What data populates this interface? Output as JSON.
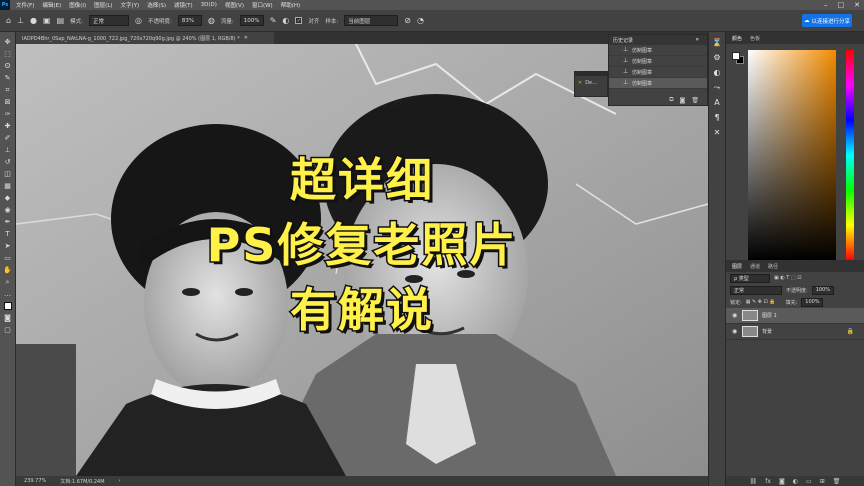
{
  "menu": {
    "app_icon": "Ps",
    "items": [
      "文件(F)",
      "编辑(E)",
      "图像(I)",
      "图层(L)",
      "文字(Y)",
      "选择(S)",
      "滤镜(T)",
      "3D(D)",
      "视图(V)",
      "窗口(W)",
      "帮助(H)"
    ],
    "window_controls": [
      "–",
      "□",
      "✕"
    ]
  },
  "options": {
    "mode_label": "模式:",
    "mode_value": "正常",
    "opacity_label": "不透明度:",
    "opacity_value": "83%",
    "flow_label": "流量:",
    "flow_value": "100%",
    "aligned_label": "对齐",
    "sample_label": "样本:",
    "sample_value": "当前图层",
    "share_label": "以连接进行分享"
  },
  "document": {
    "tab_title": "IADPD4Bhr_0Sap_NAtLNA-g_1000_722.jpg_720x720q90g.jpg @ 240% (图层 1, RGB/8) *",
    "tab_close": "✕"
  },
  "headline": {
    "line1": "超详细",
    "line2": "PS修复老照片",
    "line3": "有解说"
  },
  "status": {
    "zoom": "239.77%",
    "doc_size": "文档:1.67M/0.24M",
    "arrow": "›"
  },
  "mini_panel": {
    "label": "De..."
  },
  "history": {
    "title": "历史记录",
    "items": [
      "仿制图章",
      "仿制图章",
      "仿制图章",
      "仿制图章"
    ]
  },
  "color_panel": {
    "tabs": [
      "颜色",
      "色板"
    ],
    "hue_color": "#f28b00"
  },
  "layers_panel": {
    "tabs": [
      "图层",
      "通道",
      "路径"
    ],
    "kind_label": "ρ 类型",
    "blend_mode": "正常",
    "opacity_label": "不透明度:",
    "opacity_value": "100%",
    "fill_label": "填充:",
    "fill_value": "100%",
    "lock_label": "锁定:",
    "layers": [
      {
        "name": "图层 1",
        "active": true
      },
      {
        "name": "背景",
        "active": false
      }
    ]
  }
}
